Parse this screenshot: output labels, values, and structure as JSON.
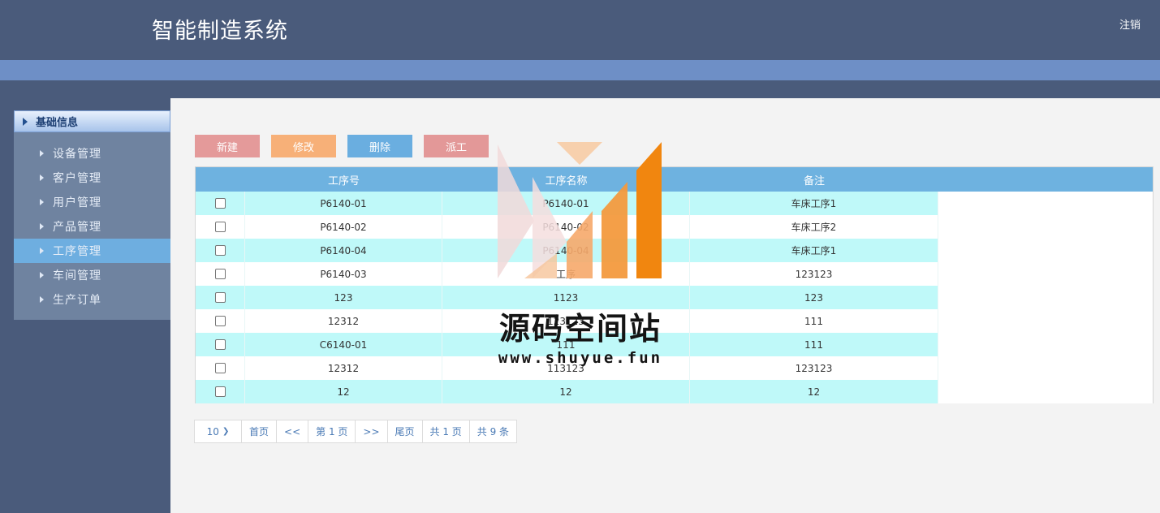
{
  "header": {
    "title": "智能制造系统",
    "logout_label": "注销"
  },
  "sidebar": {
    "group_label": "基础信息",
    "items": [
      {
        "label": "设备管理",
        "active": false
      },
      {
        "label": "客户管理",
        "active": false
      },
      {
        "label": "用户管理",
        "active": false
      },
      {
        "label": "产品管理",
        "active": false
      },
      {
        "label": "工序管理",
        "active": true
      },
      {
        "label": "车间管理",
        "active": false
      },
      {
        "label": "生产订单",
        "active": false
      }
    ]
  },
  "toolbar": {
    "new_label": "新建",
    "edit_label": "修改",
    "delete_label": "删除",
    "dispatch_label": "派工"
  },
  "table": {
    "columns": [
      "工序号",
      "工序名称",
      "备注"
    ],
    "rows": [
      {
        "code": "P6140-01",
        "name": "P6140-01",
        "remark": "车床工序1"
      },
      {
        "code": "P6140-02",
        "name": "P6140-02",
        "remark": "车床工序2"
      },
      {
        "code": "P6140-04",
        "name": "P6140-04",
        "remark": "车床工序1"
      },
      {
        "code": "P6140-03",
        "name": "工序",
        "remark": "123123"
      },
      {
        "code": "123",
        "name": "1123",
        "remark": "123"
      },
      {
        "code": "12312",
        "name": "123123",
        "remark": "111"
      },
      {
        "code": "C6140-01",
        "name": "111",
        "remark": "111"
      },
      {
        "code": "12312",
        "name": "113123",
        "remark": "123123"
      },
      {
        "code": "12",
        "name": "12",
        "remark": "12"
      }
    ]
  },
  "pager": {
    "page_size": "10",
    "first_label": "首页",
    "prev_label": "<<",
    "page_label": "第 1 页",
    "next_label": ">>",
    "last_label": "尾页",
    "total_pages_label": "共 1 页",
    "total_items_label": "共 9 条"
  },
  "watermark": {
    "text": "源码空间站",
    "url": "www.shuyue.fun"
  }
}
